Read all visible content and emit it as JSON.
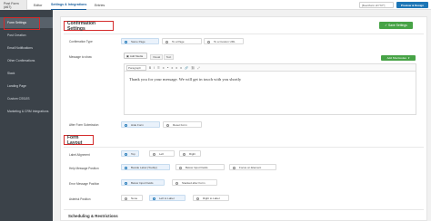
{
  "topbar": {
    "form_title": "Post Form (#67)",
    "tabs": [
      {
        "label": "Editor"
      },
      {
        "label": "Settings & Integrations"
      },
      {
        "label": "Entries"
      }
    ],
    "shortcode": "[fluentform id=\"67\"]",
    "preview_label": "Preview & Design"
  },
  "sidebar": {
    "items": [
      {
        "label": "Form Settings"
      },
      {
        "label": "Post Creation"
      },
      {
        "label": "Email Notifications"
      },
      {
        "label": "Other Confirmations"
      },
      {
        "label": "Slack"
      },
      {
        "label": "Landing Page"
      },
      {
        "label": "Custom CSS/JS"
      },
      {
        "label": "Marketing & CRM Integrations"
      }
    ]
  },
  "confirmation": {
    "title": "Confirmation Settings",
    "save_label": "Save Settings",
    "confirmation_type_label": "Confirmation Type",
    "confirmation_type_options": [
      "Same Page",
      "To a Page",
      "To a Custom URL"
    ],
    "message_label": "Message to show",
    "add_media_label": "Add Media",
    "visual_tab": "Visual",
    "text_tab": "Text",
    "add_shortcodes_label": "Add Shortcodes",
    "format_select": "Paragraph",
    "message_text": "Thank you for your message. We will get in touch with you shortly",
    "after_submission_label": "After Form Submission",
    "after_submission_options": [
      "Hide Form",
      "Reset Form"
    ]
  },
  "layout": {
    "title": "Form Layout",
    "label_alignment_label": "Label Alignment",
    "label_alignment_options": [
      "Top",
      "Left",
      "Right"
    ],
    "help_position_label": "Help Message Position",
    "help_position_options": [
      "Beside Label (Tooltip)",
      "Below Input Fields",
      "Focus on Element"
    ],
    "error_position_label": "Error Message Position",
    "error_position_options": [
      "Below Input Fields",
      "Stacked after Form"
    ],
    "asterisk_label": "Asterisk Position",
    "asterisk_options": [
      "None",
      "Left to Label",
      "Right to Label"
    ]
  },
  "scheduling": {
    "title": "Scheduling & Restrictions"
  }
}
